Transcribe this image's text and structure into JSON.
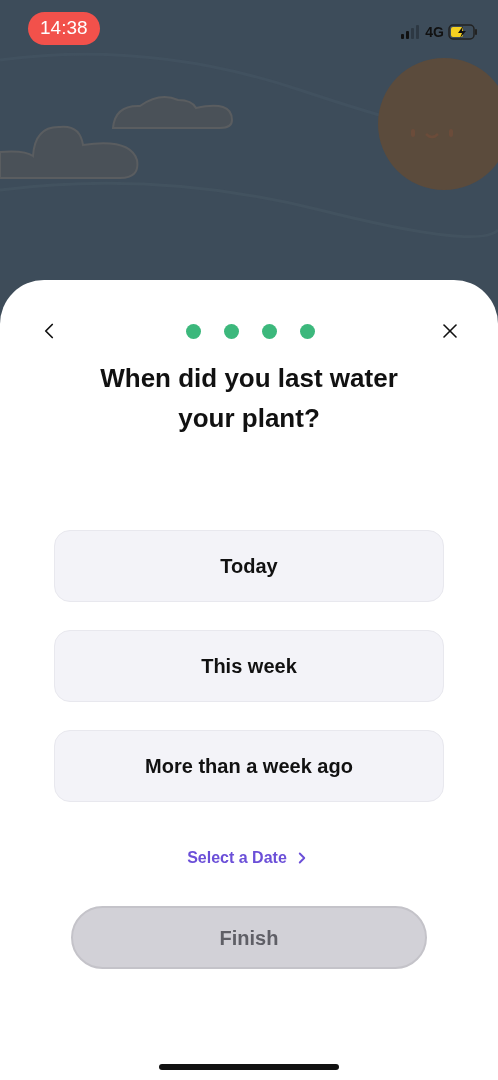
{
  "status_bar": {
    "time": "14:38",
    "network": "4G"
  },
  "steps": [
    {
      "done": true
    },
    {
      "done": true
    },
    {
      "done": true
    },
    {
      "done": true
    }
  ],
  "question": "When did you last water your plant?",
  "options": [
    {
      "label": "Today",
      "selected": false
    },
    {
      "label": "This week",
      "selected": false
    },
    {
      "label": "More than a week ago",
      "selected": false
    }
  ],
  "date_link": "Select a Date",
  "finish_button": {
    "label": "Finish",
    "disabled": true
  }
}
